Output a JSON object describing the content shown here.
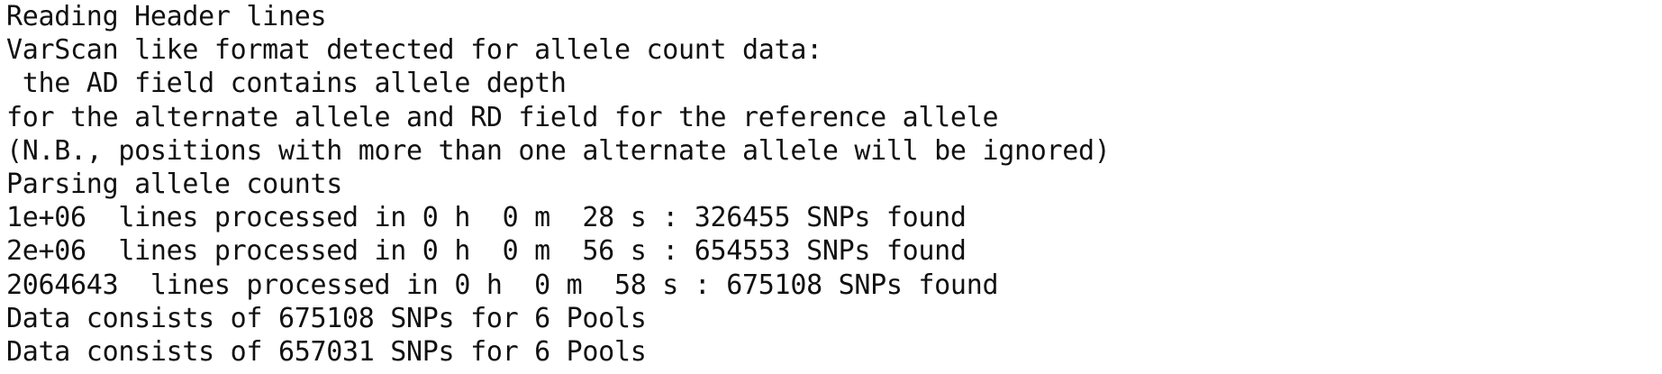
{
  "console": {
    "lines": [
      "Reading Header lines",
      "VarScan like format detected for allele count data:",
      " the AD field contains allele depth",
      "for the alternate allele and RD field for the reference allele",
      "(N.B., positions with more than one alternate allele will be ignored)",
      "Parsing allele counts",
      "1e+06  lines processed in 0 h  0 m  28 s : 326455 SNPs found",
      "2e+06  lines processed in 0 h  0 m  56 s : 654553 SNPs found",
      "2064643  lines processed in 0 h  0 m  58 s : 675108 SNPs found",
      "Data consists of 675108 SNPs for 6 Pools",
      "Data consists of 657031 SNPs for 6 Pools"
    ]
  }
}
